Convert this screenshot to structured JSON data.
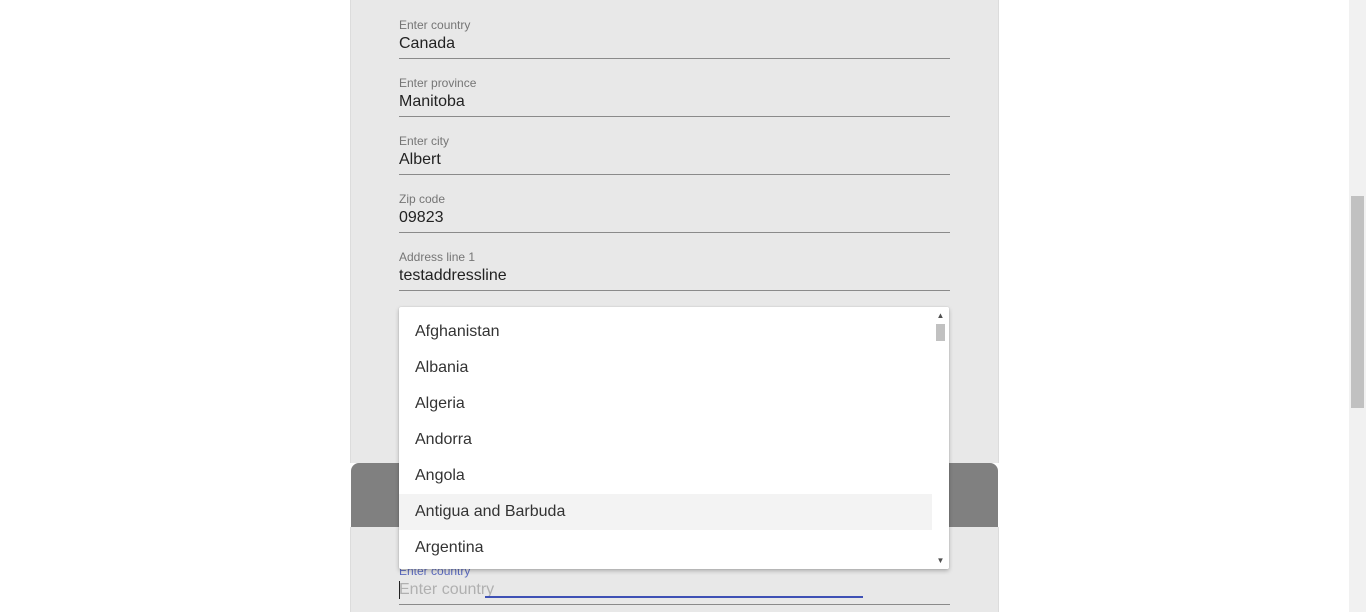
{
  "form": {
    "fields": [
      {
        "label": "Enter country",
        "value": "Canada"
      },
      {
        "label": "Enter province",
        "value": "Manitoba"
      },
      {
        "label": "Enter city",
        "value": "Albert"
      },
      {
        "label": "Zip code",
        "value": "09823"
      },
      {
        "label": "Address line 1",
        "value": "testaddressline"
      }
    ],
    "active_field": {
      "label": "Enter country",
      "placeholder": "Enter country",
      "value": ""
    }
  },
  "dropdown": {
    "options": [
      "Afghanistan",
      "Albania",
      "Algeria",
      "Andorra",
      "Angola",
      "Antigua and Barbuda",
      "Argentina"
    ],
    "highlighted": "Antigua and Barbuda"
  },
  "colors": {
    "panel_bg": "#e8e8e8",
    "header_bg": "#808080",
    "focus_accent": "#3f51b5",
    "active_label": "#5c6bc0"
  }
}
